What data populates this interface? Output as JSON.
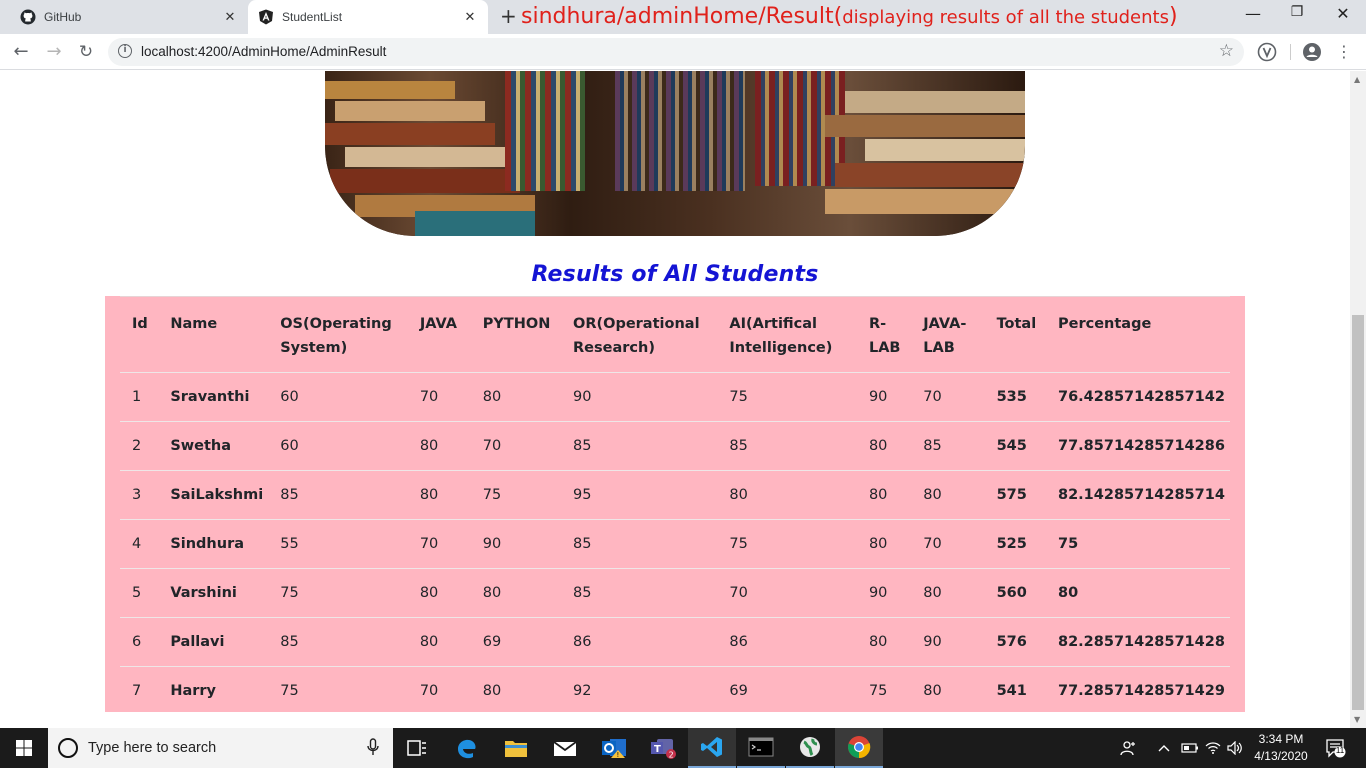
{
  "browser": {
    "tabs": [
      {
        "title": "GitHub",
        "icon": "github-icon"
      },
      {
        "title": "StudentList",
        "icon": "angular-icon",
        "active": true
      }
    ],
    "new_tab_symbol": "+",
    "annotation_main": "sindhura/adminHome/Result(",
    "annotation_sub": "displaying results of all the students",
    "annotation_close": ")",
    "url": "localhost:4200/AdminHome/AdminResult"
  },
  "page": {
    "title": "Results of All Students"
  },
  "table": {
    "headers": [
      [
        "Id"
      ],
      [
        "Name"
      ],
      [
        "OS(Operating",
        "System)"
      ],
      [
        "JAVA"
      ],
      [
        "PYTHON"
      ],
      [
        "OR(Operational",
        "Research)"
      ],
      [
        "AI(Artifical",
        "Intelligence)"
      ],
      [
        "R-",
        "LAB"
      ],
      [
        "JAVA-",
        "LAB"
      ],
      [
        "Total"
      ],
      [
        "Percentage"
      ]
    ],
    "rows": [
      [
        "1",
        "Sravanthi",
        "60",
        "70",
        "80",
        "90",
        "75",
        "90",
        "70",
        "535",
        "76.42857142857142"
      ],
      [
        "2",
        "Swetha",
        "60",
        "80",
        "70",
        "85",
        "85",
        "80",
        "85",
        "545",
        "77.85714285714286"
      ],
      [
        "3",
        "SaiLakshmi",
        "85",
        "80",
        "75",
        "95",
        "80",
        "80",
        "80",
        "575",
        "82.14285714285714"
      ],
      [
        "4",
        "Sindhura",
        "55",
        "70",
        "90",
        "85",
        "75",
        "80",
        "70",
        "525",
        "75"
      ],
      [
        "5",
        "Varshini",
        "75",
        "80",
        "80",
        "85",
        "70",
        "90",
        "80",
        "560",
        "80"
      ],
      [
        "6",
        "Pallavi",
        "85",
        "80",
        "69",
        "86",
        "86",
        "80",
        "90",
        "576",
        "82.28571428571428"
      ],
      [
        "7",
        "Harry",
        "75",
        "70",
        "80",
        "92",
        "69",
        "75",
        "80",
        "541",
        "77.28571428571429"
      ]
    ]
  },
  "taskbar": {
    "search_placeholder": "Type here to search",
    "time": "3:34 PM",
    "date": "4/13/2020",
    "notification_count": "11"
  },
  "colors": {
    "table_bg": "#ffb6c1",
    "title": "#1414d4",
    "annotation": "#e0211b"
  }
}
